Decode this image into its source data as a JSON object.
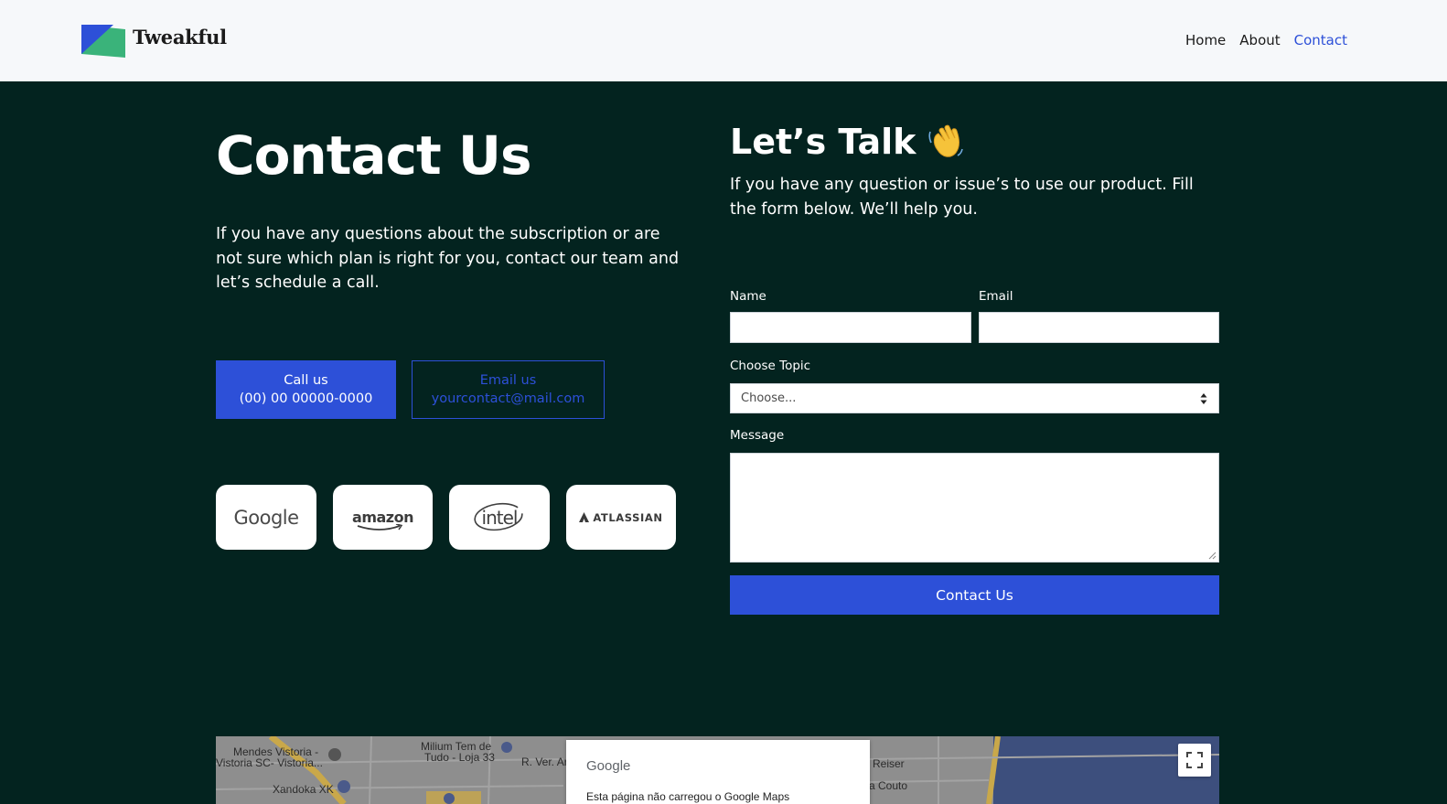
{
  "header": {
    "brand": "Tweakful",
    "nav": [
      {
        "label": "Home",
        "active": false
      },
      {
        "label": "About",
        "active": false
      },
      {
        "label": "Contact",
        "active": true
      }
    ]
  },
  "intro": {
    "title": "Contact Us",
    "description": "If you have any questions about the subscription or are not sure which plan is right for you, contact our team and let’s schedule a call."
  },
  "actions": {
    "call_label": "Call us",
    "call_value": "(00) 00 00000-0000",
    "email_label": "Email us",
    "email_value": "yourcontact@mail.com"
  },
  "partners": [
    "Google",
    "amazon",
    "intel",
    "ATLASSIAN"
  ],
  "form": {
    "title": "Let’s Talk",
    "title_emoji": "waving-hand-icon",
    "description": "If you have any question or issue’s to use our product. Fill the form below. We’ll help you.",
    "name_label": "Name",
    "name_value": "",
    "email_label": "Email",
    "email_value": "",
    "topic_label": "Choose Topic",
    "topic_selected": "Choose...",
    "message_label": "Message",
    "message_value": "",
    "submit_label": "Contact Us"
  },
  "map": {
    "labels": [
      "Mendes Vistoria -",
      "Vistoria SC- Vistoria...",
      "Milium Tem de",
      "Tudo - Loja 33",
      "R. Ver. Ar",
      "Xandoka XK",
      "Reiser",
      "a Couto"
    ],
    "dialog_brand": "Google",
    "dialog_message": "Esta página não carregou o Google Maps"
  },
  "colors": {
    "accent": "#2d50d8",
    "background": "#03231f",
    "header_bg": "#f6f8fa"
  }
}
